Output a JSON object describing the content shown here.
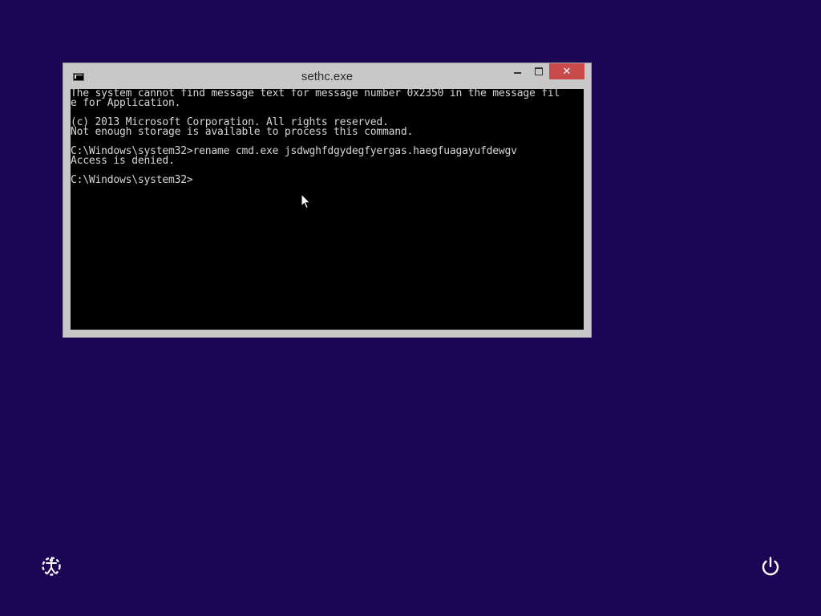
{
  "window": {
    "title": "sethc.exe",
    "close_glyph": "✕",
    "icon": "console-icon"
  },
  "console": {
    "lines": [
      "The system cannot find message text for message number 0x2350 in the message fil",
      "e for Application.",
      "",
      "(c) 2013 Microsoft Corporation. All rights reserved.",
      "Not enough storage is available to process this command.",
      "",
      "C:\\Windows\\system32>rename cmd.exe jsdwghfdgydegfyergas.haegfuagayufdewgv",
      "Access is denied.",
      "",
      "C:\\Windows\\system32>"
    ]
  },
  "bottom": {
    "left_icon": "ease-of-access-icon",
    "right_icon": "power-icon"
  },
  "colors": {
    "background": "#1a0655",
    "console_bg": "#000000",
    "console_fg": "#d6d6d6",
    "close_button": "#c94a4a",
    "frame": "#c8c8c8"
  }
}
